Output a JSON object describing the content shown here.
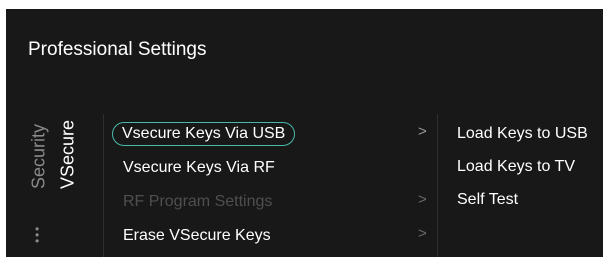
{
  "header": {
    "title": "Professional Settings"
  },
  "side_tabs": {
    "security": "Security",
    "vsecure": "VSecure"
  },
  "menu": {
    "items": [
      {
        "label": "Vsecure Keys Via USB",
        "state": "selected",
        "has_submenu": true,
        "chevron": ">"
      },
      {
        "label": "Vsecure Keys Via RF",
        "state": "normal",
        "has_submenu": false,
        "chevron": ""
      },
      {
        "label": "RF Program Settings",
        "state": "disabled",
        "has_submenu": true,
        "chevron": ">"
      },
      {
        "label": "Erase VSecure Keys",
        "state": "normal",
        "has_submenu": true,
        "chevron": ">"
      }
    ]
  },
  "submenu": {
    "items": [
      {
        "label": "Load Keys to USB"
      },
      {
        "label": "Load Keys to TV"
      },
      {
        "label": "Self Test"
      }
    ]
  },
  "colors": {
    "background": "#181818",
    "accent": "#48b8a8",
    "text": "#ffffff",
    "disabled_text": "#4f4f4f",
    "inactive_tab": "#8a8a8a"
  },
  "icons": {
    "more": "more-dots-icon",
    "chevron": "chevron-right-icon"
  }
}
